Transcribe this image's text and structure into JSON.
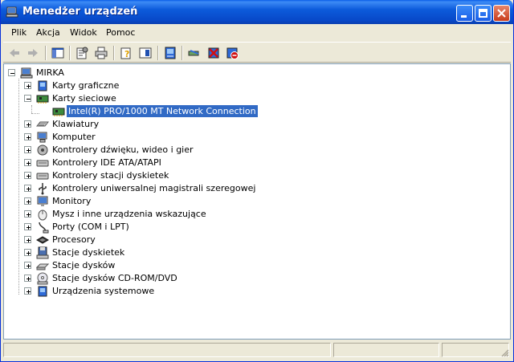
{
  "window": {
    "title": "Menedżer urządzeń",
    "controls": [
      "minimize-icon",
      "maximize-icon",
      "close-icon"
    ]
  },
  "menu": [
    "Plik",
    "Akcja",
    "Widok",
    "Pomoc"
  ],
  "toolbar": {
    "buttons": [
      "back-icon",
      "forward-icon",
      "show-hide-tree-icon",
      "properties-icon",
      "print-icon",
      "help-icon",
      "view-icon",
      "update-driver-icon",
      "scan-hardware-icon",
      "uninstall-icon",
      "disable-icon"
    ]
  },
  "tree": {
    "root": "MIRKA",
    "items": [
      {
        "label": "Karty graficzne",
        "icon": "display-adapter-icon",
        "expanded": false
      },
      {
        "label": "Karty sieciowe",
        "icon": "network-adapter-icon",
        "expanded": true,
        "children": [
          {
            "label": "Intel(R) PRO/1000 MT Network Connection",
            "icon": "network-card-icon",
            "selected": true
          }
        ]
      },
      {
        "label": "Klawiatury",
        "icon": "keyboard-icon",
        "expanded": false
      },
      {
        "label": "Komputer",
        "icon": "computer-icon",
        "expanded": false
      },
      {
        "label": "Kontrolery dźwięku, wideo i gier",
        "icon": "sound-icon",
        "expanded": false
      },
      {
        "label": "Kontrolery IDE ATA/ATAPI",
        "icon": "ide-icon",
        "expanded": false
      },
      {
        "label": "Kontrolery stacji dyskietek",
        "icon": "floppy-controller-icon",
        "expanded": false
      },
      {
        "label": "Kontrolery uniwersalnej magistrali szeregowej",
        "icon": "usb-icon",
        "expanded": false
      },
      {
        "label": "Monitory",
        "icon": "monitor-icon",
        "expanded": false
      },
      {
        "label": "Mysz i inne urządzenia wskazujące",
        "icon": "mouse-icon",
        "expanded": false
      },
      {
        "label": "Porty (COM i LPT)",
        "icon": "port-icon",
        "expanded": false
      },
      {
        "label": "Procesory",
        "icon": "processor-icon",
        "expanded": false
      },
      {
        "label": "Stacje dyskietek",
        "icon": "floppy-drive-icon",
        "expanded": false
      },
      {
        "label": "Stacje dysków",
        "icon": "disk-drive-icon",
        "expanded": false
      },
      {
        "label": "Stacje dysków CD-ROM/DVD",
        "icon": "cdrom-icon",
        "expanded": false
      },
      {
        "label": "Urządzenia systemowe",
        "icon": "system-devices-icon",
        "expanded": false
      }
    ]
  },
  "colors": {
    "titlebar": "#0A5FE8",
    "selection": "#316AC5",
    "face": "#ECE9D8"
  }
}
